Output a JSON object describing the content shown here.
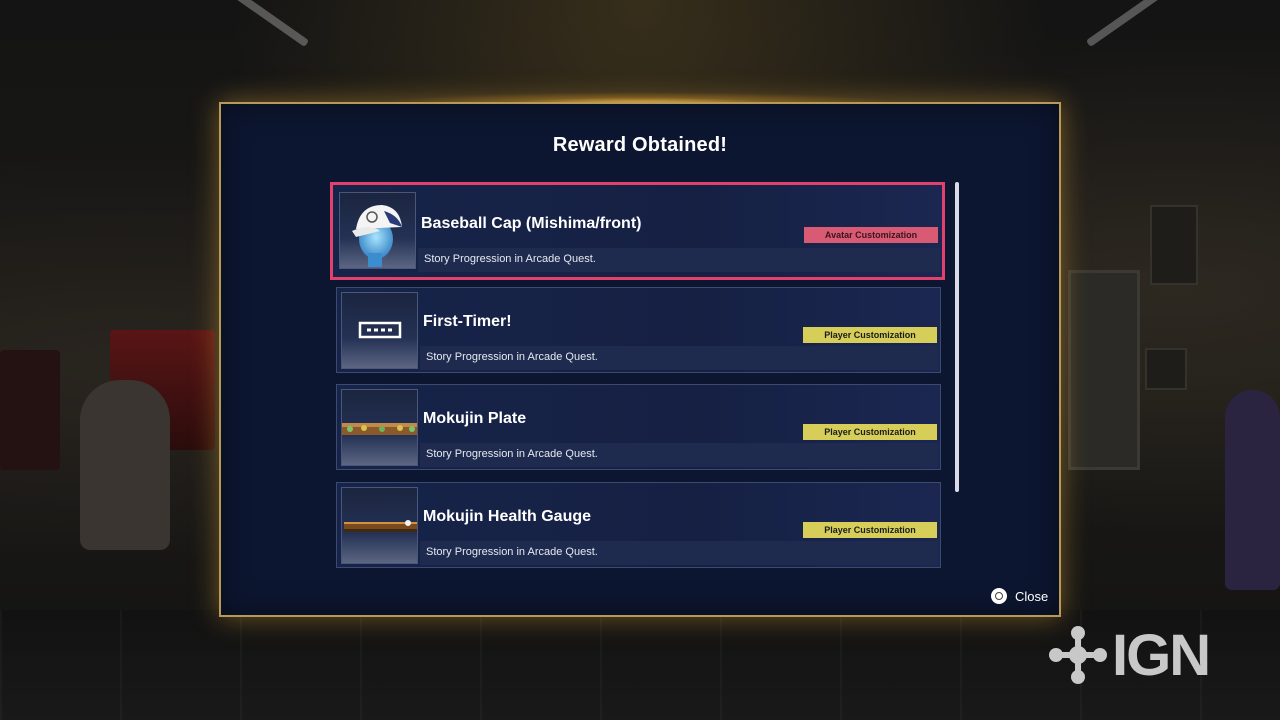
{
  "dialog": {
    "title": "Reward Obtained!",
    "close_label": "Close"
  },
  "rewards": [
    {
      "name": "Baseball Cap (Mishima/front)",
      "description": "Story Progression in Arcade Quest.",
      "category": "Avatar Customization",
      "category_color": "#d85b73",
      "icon": "baseball-cap-avatar",
      "selected": true
    },
    {
      "name": "First-Timer!",
      "description": "Story Progression in Arcade Quest.",
      "category": "Player Customization",
      "category_color": "#d6ce58",
      "icon": "title-plate-dots",
      "selected": false
    },
    {
      "name": "Mokujin Plate",
      "description": "Story Progression in Arcade Quest.",
      "category": "Player Customization",
      "category_color": "#d6ce58",
      "icon": "wood-plate-banner",
      "selected": false
    },
    {
      "name": "Mokujin Health Gauge",
      "description": "Story Progression in Arcade Quest.",
      "category": "Player Customization",
      "category_color": "#d6ce58",
      "icon": "wood-health-gauge",
      "selected": false
    }
  ],
  "watermark": {
    "text": "IGN"
  },
  "colors": {
    "dialog_bg": "#0d1630",
    "dialog_border": "#b79a55",
    "selection_border": "#e2416e"
  }
}
